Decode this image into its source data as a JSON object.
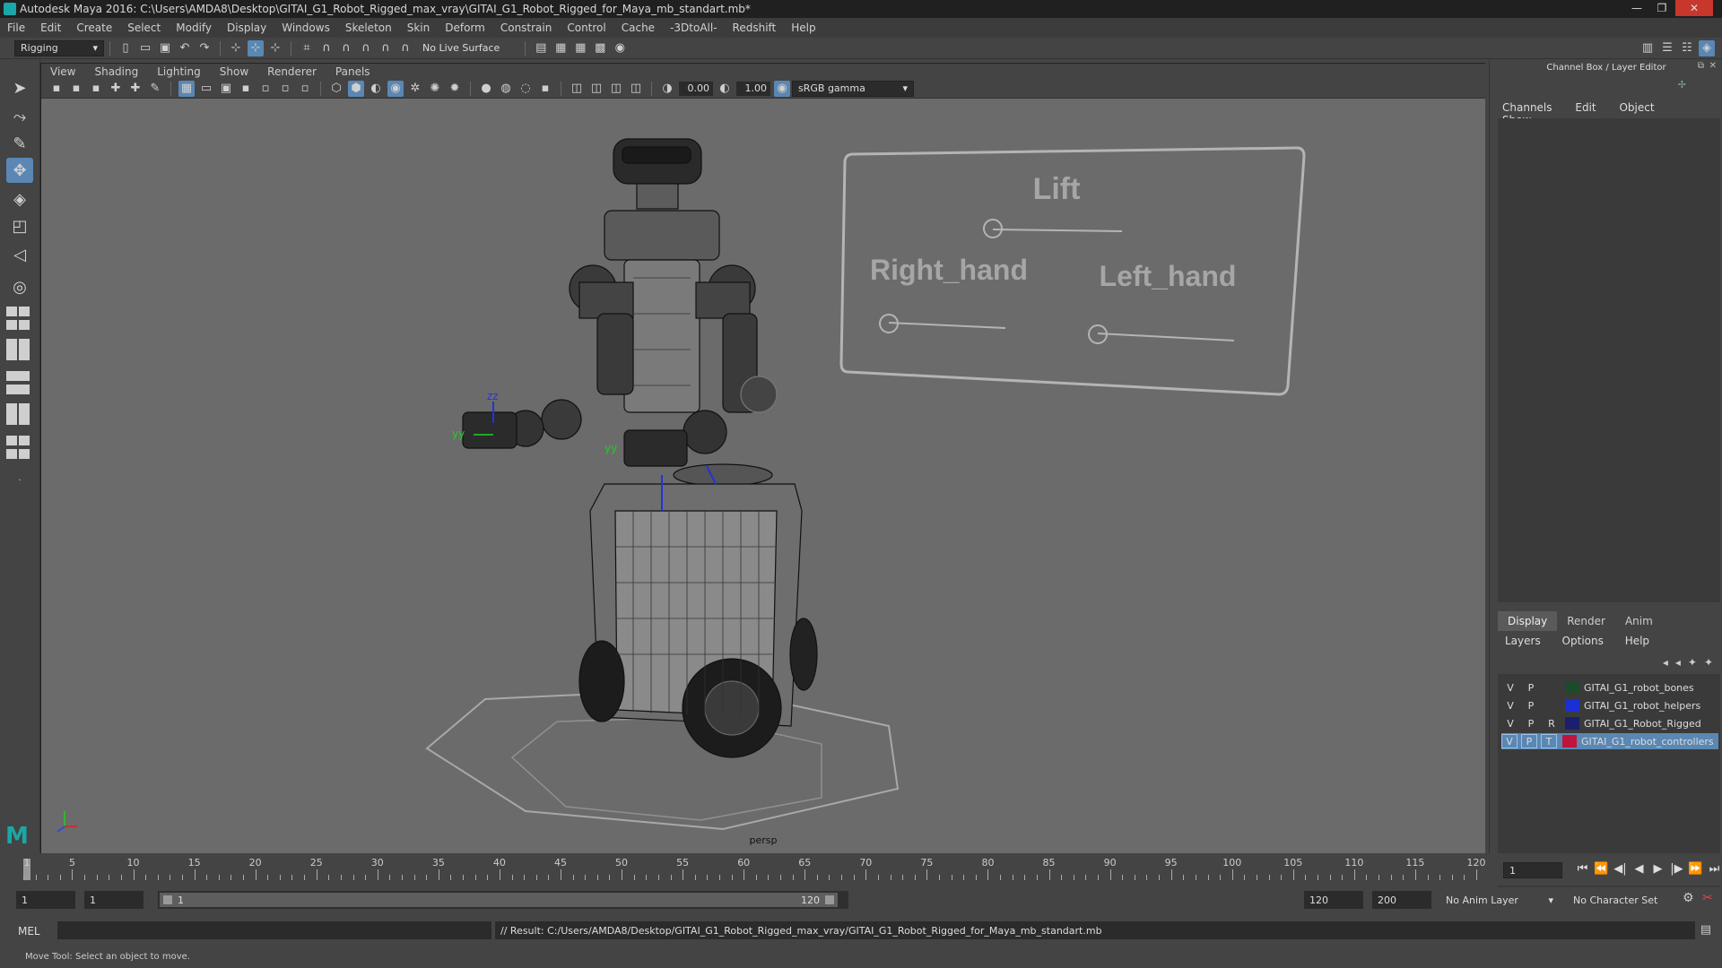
{
  "window": {
    "title": "Autodesk Maya 2016: C:\\Users\\AMDA8\\Desktop\\GITAI_G1_Robot_Rigged_max_vray\\GITAI_G1_Robot_Rigged_for_Maya_mb_standart.mb*",
    "minimize": "—",
    "maximize": "❐",
    "close": "✕"
  },
  "menubar": [
    "File",
    "Edit",
    "Create",
    "Select",
    "Modify",
    "Display",
    "Windows",
    "Skeleton",
    "Skin",
    "Deform",
    "Constrain",
    "Control",
    "Cache",
    "-3DtoAll-",
    "Redshift",
    "Help"
  ],
  "status": {
    "mode": "Rigging",
    "live_surface": "No Live Surface"
  },
  "viewport": {
    "menu": [
      "View",
      "Shading",
      "Lighting",
      "Show",
      "Renderer",
      "Panels"
    ],
    "near_value": "0.00",
    "far_value": "1.00",
    "color_space": "sRGB gamma",
    "camera_label": "persp",
    "controls": {
      "title": "Lift",
      "right": "Right_hand",
      "left": "Left_hand"
    },
    "axes": {
      "z": "zz",
      "y": "yy"
    }
  },
  "channel_box": {
    "title": "Channel Box / Layer Editor",
    "menu": [
      "Channels",
      "Edit",
      "Object",
      "Show"
    ],
    "tabs": [
      "Display",
      "Render",
      "Anim"
    ],
    "active_tab": "Display",
    "layer_menu": [
      "Layers",
      "Options",
      "Help"
    ],
    "layers": [
      {
        "v": "V",
        "p": "P",
        "t": "",
        "name": "GITAI_G1_robot_bones",
        "color": "#1d4a2a"
      },
      {
        "v": "V",
        "p": "P",
        "t": "",
        "name": "GITAI_G1_robot_helpers",
        "color": "#1a2fd6"
      },
      {
        "v": "V",
        "p": "P",
        "t": "R",
        "name": "GITAI_G1_Robot_Rigged",
        "color": "#1b1f6e"
      },
      {
        "v": "V",
        "p": "P",
        "t": "T",
        "name": "GITAI_G1_robot_controllers",
        "color": "#c0143c",
        "selected": true
      }
    ]
  },
  "timeline": {
    "labels": [
      "1",
      "5",
      "10",
      "15",
      "20",
      "25",
      "30",
      "35",
      "40",
      "45",
      "50",
      "55",
      "60",
      "65",
      "70",
      "75",
      "80",
      "85",
      "90",
      "95",
      "100",
      "105",
      "110",
      "115",
      "120"
    ],
    "current_frame": "1",
    "range_start": "1",
    "playback_start": "1",
    "range_handle_start": "1",
    "range_handle_end": "120",
    "playback_end": "120",
    "range_end": "200",
    "anim_layer": "No Anim Layer",
    "character_set": "No Character Set"
  },
  "command": {
    "language": "MEL",
    "result": "// Result: C:/Users/AMDA8/Desktop/GITAI_G1_Robot_Rigged_max_vray/GITAI_G1_Robot_Rigged_for_Maya_mb_standart.mb"
  },
  "help_line": "Move Tool: Select an object to move."
}
